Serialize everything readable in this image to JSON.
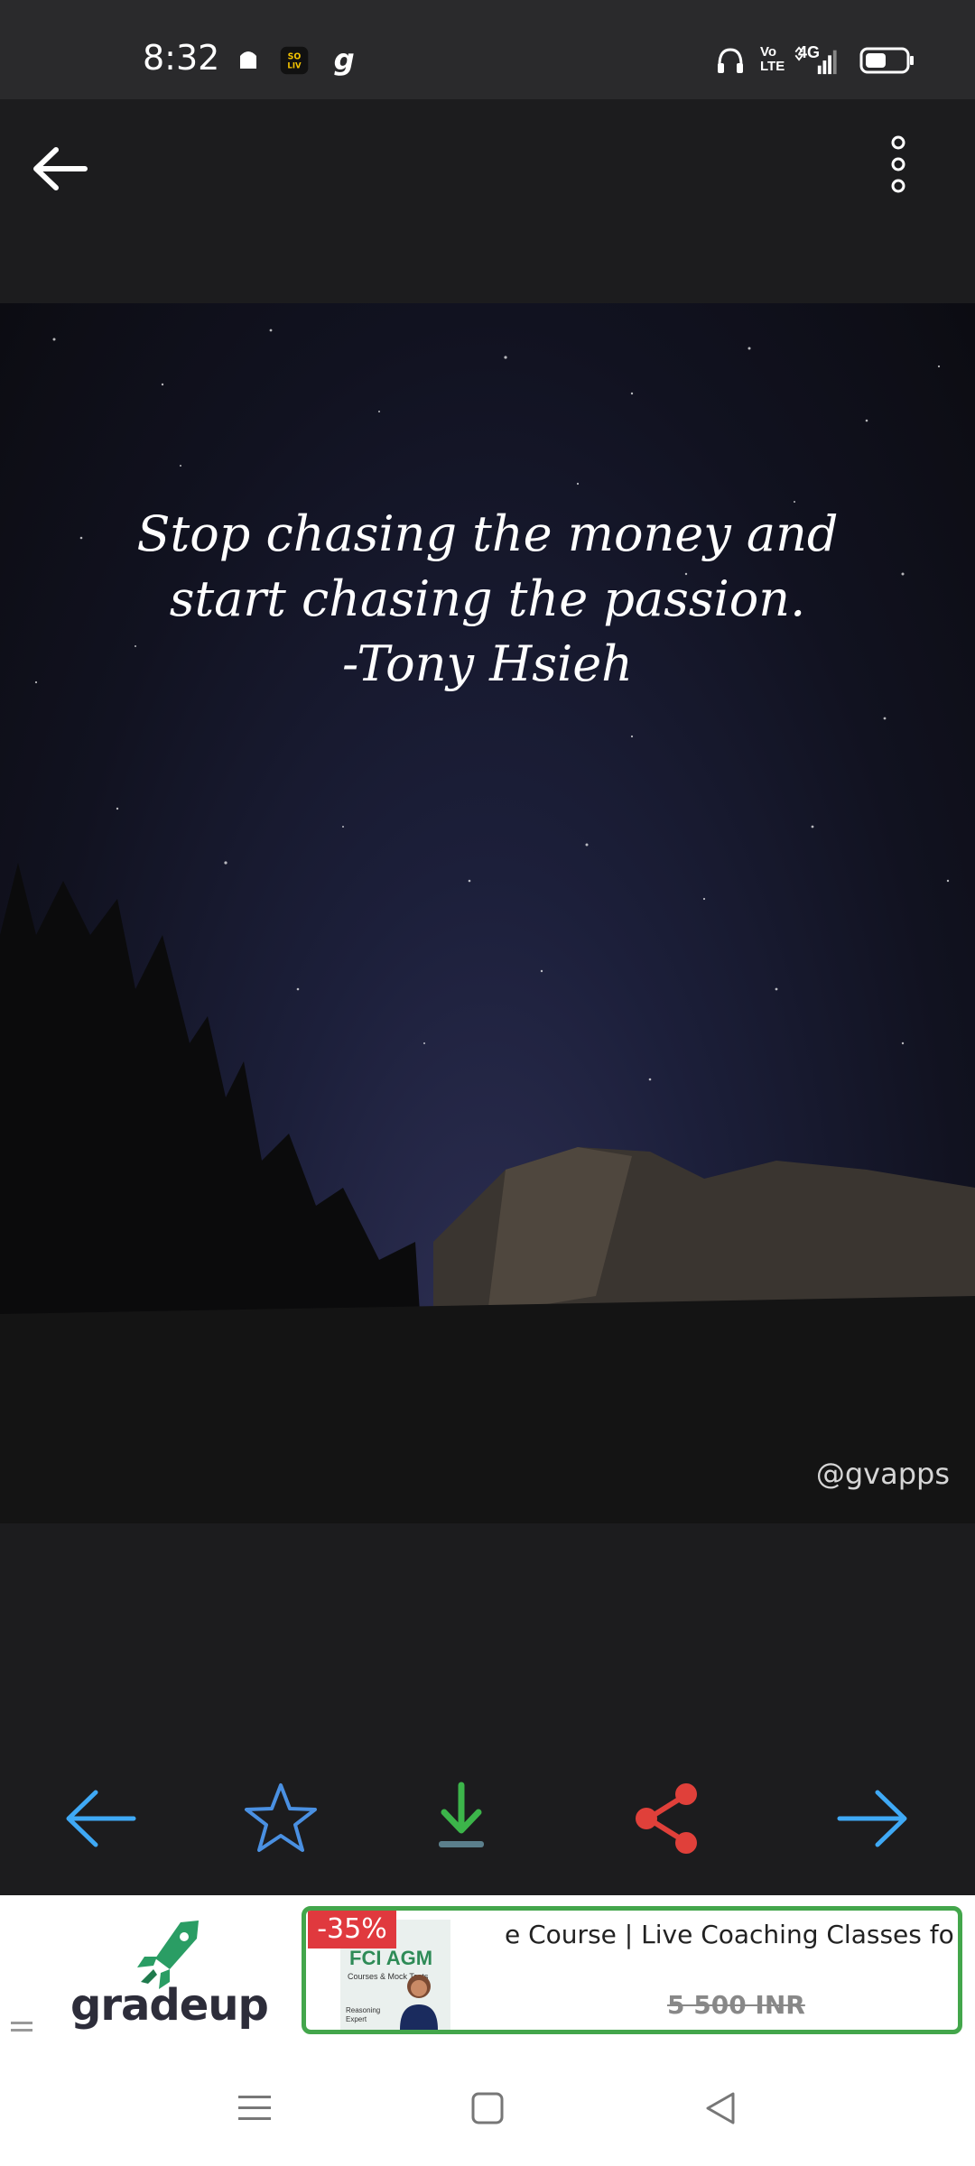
{
  "status_bar": {
    "time": "8:32",
    "icons": [
      "notification-bell-icon",
      "sonyliv-app-icon",
      "gradeup-app-icon",
      "headphones-icon",
      "volte-icon",
      "4g-signal-icon",
      "battery-icon"
    ],
    "volte_label": "Vo LTE",
    "network_label": "4G"
  },
  "toolbar": {
    "back_icon": "arrow-left-icon",
    "more_icon": "more-vertical-icon"
  },
  "quote": {
    "lines": [
      "Stop chasing the money and",
      "start chasing the passion.",
      "-Tony Hsieh"
    ],
    "watermark": "@gvapps"
  },
  "actions": {
    "items": [
      {
        "name": "previous",
        "icon": "arrow-left-icon",
        "color": "#3fa9f5"
      },
      {
        "name": "favorite",
        "icon": "star-outline-icon",
        "color": "#4a90e2"
      },
      {
        "name": "download",
        "icon": "download-icon",
        "color": "#3cb54a"
      },
      {
        "name": "share",
        "icon": "share-icon",
        "color": "#e0403a"
      },
      {
        "name": "next",
        "icon": "arrow-right-icon",
        "color": "#3fa9f5"
      }
    ]
  },
  "ad": {
    "brand": "gradeup",
    "discount": "-35%",
    "thumbnail_title": "FCI AGM",
    "thumbnail_sub": "Courses & Mock Tests",
    "thumbnail_caption": "Reasoning Expert",
    "title": "e Course | Live Coaching Classes for Exa",
    "price": "5 500 INR",
    "accent": "#43a64b"
  },
  "nav": {
    "icons": [
      "menu-icon",
      "home-square-icon",
      "back-triangle-icon"
    ]
  }
}
